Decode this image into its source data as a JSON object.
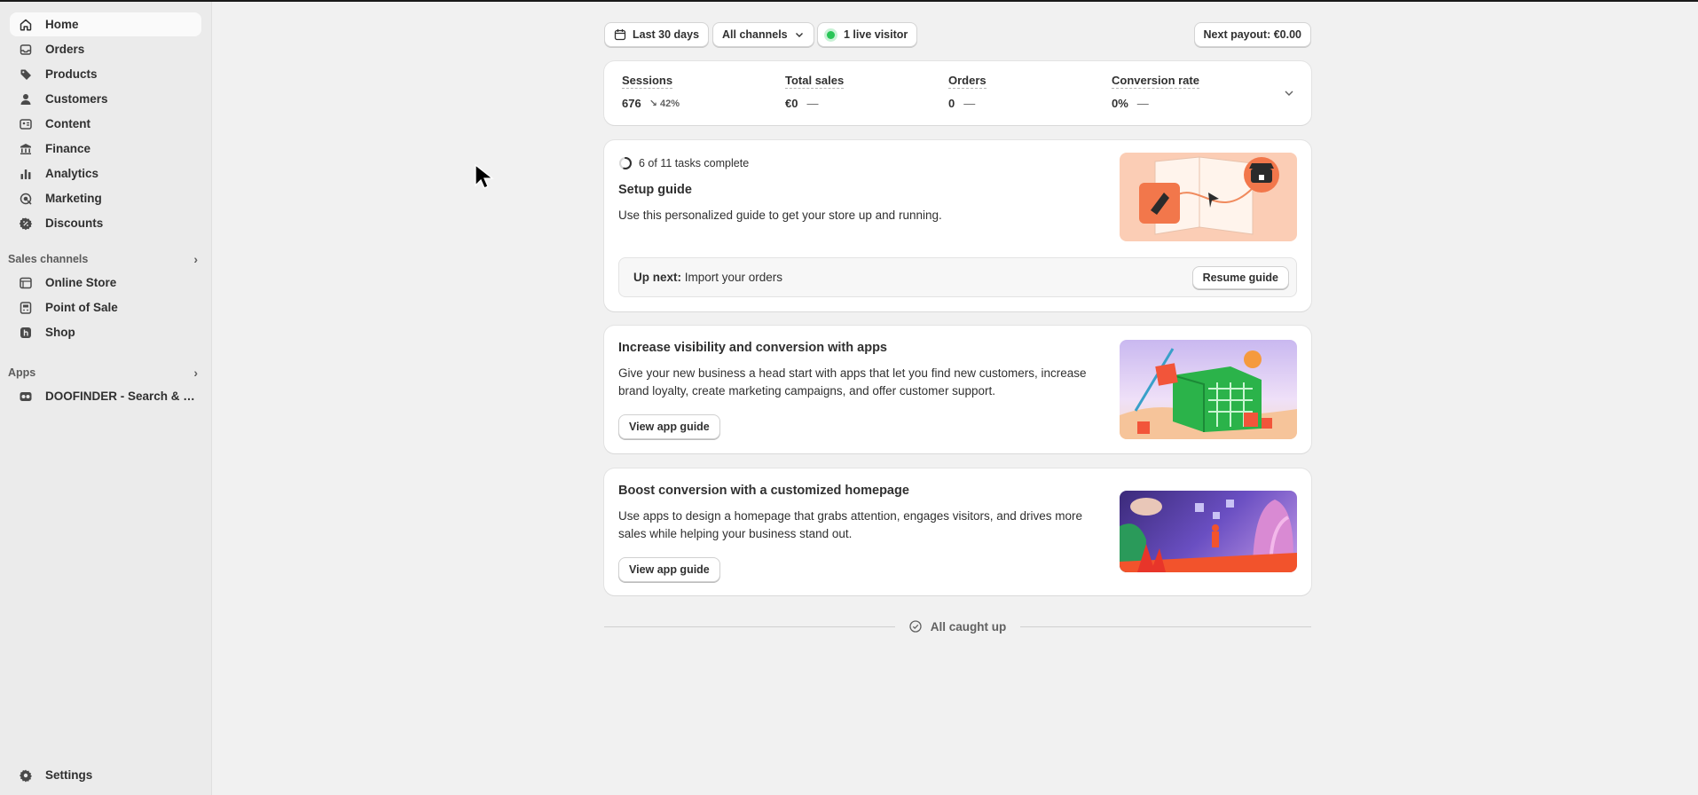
{
  "sidebar": {
    "nav": [
      {
        "label": "Home",
        "icon": "home-icon"
      },
      {
        "label": "Orders",
        "icon": "inbox-icon"
      },
      {
        "label": "Products",
        "icon": "tag-icon"
      },
      {
        "label": "Customers",
        "icon": "person-icon"
      },
      {
        "label": "Content",
        "icon": "content-icon"
      },
      {
        "label": "Finance",
        "icon": "bank-icon"
      },
      {
        "label": "Analytics",
        "icon": "bar-chart-icon"
      },
      {
        "label": "Marketing",
        "icon": "target-icon"
      },
      {
        "label": "Discounts",
        "icon": "discount-icon"
      }
    ],
    "sales_channels": {
      "heading": "Sales channels",
      "items": [
        {
          "label": "Online Store",
          "icon": "store-icon"
        },
        {
          "label": "Point of Sale",
          "icon": "pos-icon"
        },
        {
          "label": "Shop",
          "icon": "shop-icon"
        }
      ]
    },
    "apps": {
      "heading": "Apps",
      "items": [
        {
          "label": "DOOFINDER - Search & Di...",
          "icon": "doofinder-icon"
        }
      ]
    },
    "settings_label": "Settings"
  },
  "toolbar": {
    "date_range": "Last 30 days",
    "channels": "All channels",
    "live_visitors": "1 live visitor",
    "payout": "Next payout: €0.00"
  },
  "metrics": [
    {
      "label": "Sessions",
      "value": "676",
      "delta": "↘ 42%"
    },
    {
      "label": "Total sales",
      "value": "€0",
      "dash": "—"
    },
    {
      "label": "Orders",
      "value": "0",
      "dash": "—"
    },
    {
      "label": "Conversion rate",
      "value": "0%",
      "dash": "—"
    }
  ],
  "setup": {
    "progress": "6 of 11 tasks complete",
    "progress_fraction": 0.545,
    "title": "Setup guide",
    "description": "Use this personalized guide to get your store up and running.",
    "up_next_label": "Up next:",
    "up_next_task": "Import your orders",
    "resume_button": "Resume guide"
  },
  "apps_card": {
    "title": "Increase visibility and conversion with apps",
    "description_line1": "Give your new business a head start with apps that let you find new customers, increase",
    "description_line2": "brand loyalty, create marketing campaigns, and offer customer support.",
    "button": "View app guide"
  },
  "homepage_card": {
    "title": "Boost conversion with a customized homepage",
    "description_line1": "Use apps to design a homepage that grabs attention, engages visitors, and drives more",
    "description_line2": "sales while helping your business stand out.",
    "button": "View app guide"
  },
  "footer": {
    "caught_up": "All caught up"
  },
  "colors": {
    "live_dot": "#29c557",
    "accent_peach": "#fbcdb5",
    "accent_green": "#2bb34a"
  }
}
